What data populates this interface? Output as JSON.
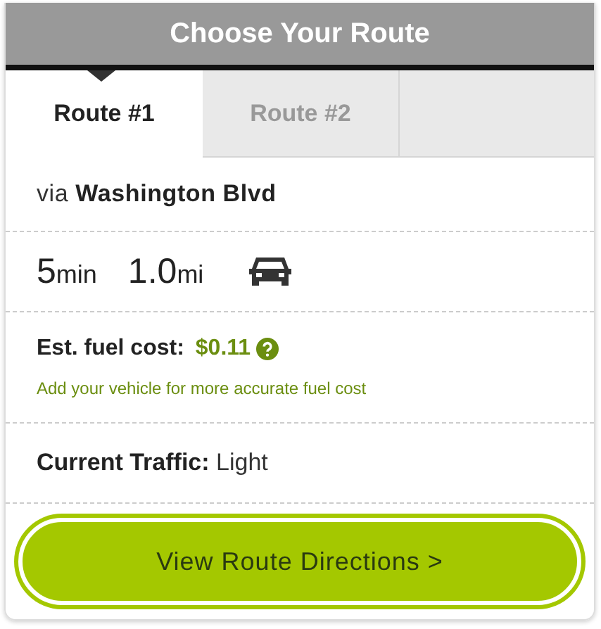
{
  "header": {
    "title": "Choose Your Route"
  },
  "tabs": [
    {
      "label": "Route #1",
      "selected": true
    },
    {
      "label": "Route #2",
      "selected": false
    }
  ],
  "via": "via **Washington Blvd**",
  "stats": [
    {
      "value": "5",
      "unit": "min"
    },
    {
      "value": "1.0",
      "unit": "mi"
    }
  ],
  "fuel": {
    "label": "Est. fuel cost:",
    "value": "$0.11",
    "note": "Add your vehicle for more accurate fuel cost"
  },
  "traffic": "**Current Traffic:** Light",
  "button": {
    "label": "View Route Directions >"
  }
}
